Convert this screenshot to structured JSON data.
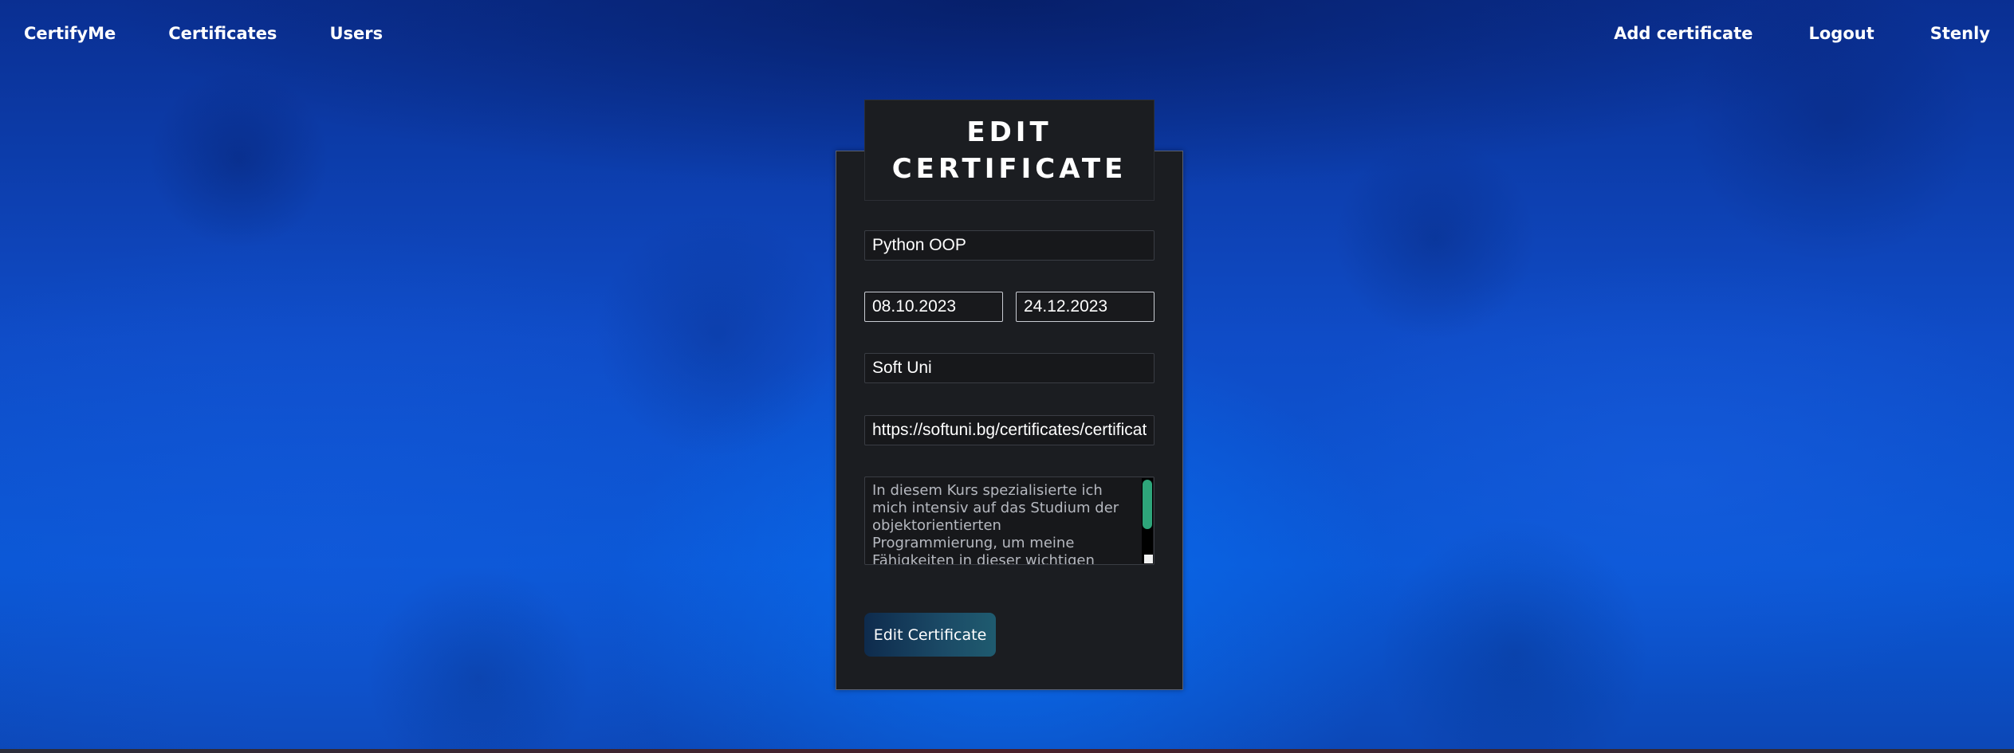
{
  "nav": {
    "brand": "CertifyMe",
    "left_items": [
      "Certificates",
      "Users"
    ],
    "right_items": [
      "Add certificate",
      "Logout",
      "Stenly"
    ]
  },
  "form": {
    "title": "EDIT CERTIFICATE",
    "name": "Python OOP",
    "start_date": "08.10.2023",
    "end_date": "24.12.2023",
    "issuer": "Soft Uni",
    "url": "https://softuni.bg/certificates/certificat",
    "description": "In diesem Kurs spezialisierte ich\nmich intensiv auf das Studium der\n            objektorientierten\nProgrammierung, um meine\nFähigkeiten in dieser wichtigen",
    "submit_label": "Edit Certificate"
  },
  "colors": {
    "card_bg": "#1b1d21",
    "scroll_thumb": "#2ea57a",
    "button_start": "#0e2b4d",
    "button_end": "#1f5b6f"
  }
}
